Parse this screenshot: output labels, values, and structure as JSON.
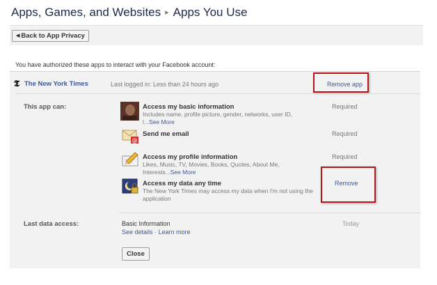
{
  "header": {
    "crumb_root": "Apps, Games, and Websites",
    "separator": "▸",
    "crumb_current": "Apps You Use"
  },
  "toolbar": {
    "back_label": "Back to App Privacy"
  },
  "main": {
    "authorized_text": "You have authorized these apps to interact with your Facebook account:",
    "app": {
      "logo_glyph": "𝕿",
      "name": "The New York Times",
      "last_logged_in": "Last logged in: Less than 24 hours ago",
      "remove_app_label": "Remove app"
    },
    "this_app_can_label": "This app can:",
    "permissions": [
      {
        "icon": "profile-photo",
        "title": "Access my basic information",
        "description": "Includes name, profile picture, gender, networks, user ID, l...",
        "see_more": "See More",
        "status": "Required"
      },
      {
        "icon": "envelope-icon",
        "title": "Send me email",
        "status": "Required"
      },
      {
        "icon": "profile-pencil-icon",
        "title": "Access my profile information",
        "description": "Likes, Music, TV, Movies, Books, Quotes, About Me, Interests...",
        "see_more": "See More",
        "status": "Required"
      },
      {
        "icon": "offline-access-icon",
        "title": "Access my data any time",
        "description": "The New York Times may access my data when I'm not using the application",
        "remove_label": "Remove"
      }
    ],
    "last_data_access": {
      "label": "Last data access:",
      "value": "Basic Information",
      "see_details": "See details",
      "separator": "·",
      "learn_more": "Learn more",
      "when": "Today"
    },
    "close_label": "Close"
  },
  "colors": {
    "link": "#3b5998",
    "highlight": "#b9131c",
    "panel": "#f2f2f2"
  }
}
